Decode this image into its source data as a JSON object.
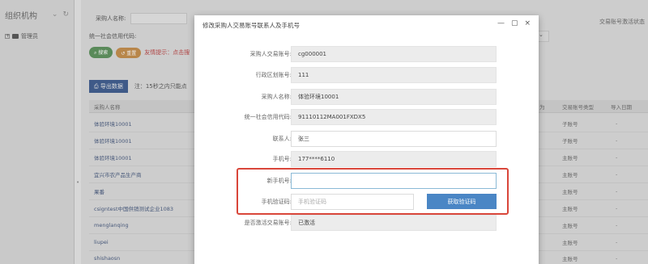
{
  "org_panel": {
    "title": "组织机构",
    "tree_root": "管理员"
  },
  "filters": {
    "purchaser_name_label": "采购人名称:",
    "credit_code_label": "统一社会信用代码:",
    "search_label": "搜索",
    "reset_label": "重置",
    "tip": "友情提示：点击搜",
    "right_text": "交易账号激活状态"
  },
  "toolbar": {
    "export_label": "导出数据",
    "note": "注：15秒之内只能点"
  },
  "table": {
    "head": {
      "name": "采购人名称",
      "col_a": "为",
      "col_type": "交易账号类型",
      "col_date": "导入日期"
    },
    "rows": [
      {
        "name": "体验环境10001",
        "type": "子账号",
        "dash": "-"
      },
      {
        "name": "体验环境10001",
        "type": "子账号",
        "dash": "-"
      },
      {
        "name": "体验环境10001",
        "type": "主账号",
        "dash": "-"
      },
      {
        "name": "宜兴市农产品生产商",
        "type": "主账号",
        "dash": "-"
      },
      {
        "name": "果番",
        "type": "主账号",
        "dash": "-"
      },
      {
        "name": "csigntest中国供销测试企业1083",
        "type": "主账号",
        "dash": "-"
      },
      {
        "name": "menglanqing",
        "type": "主账号",
        "dash": "-"
      },
      {
        "name": "liupei",
        "type": "主账号",
        "dash": "-"
      },
      {
        "name": "shishaosn",
        "type": "主账号",
        "dash": "-"
      }
    ]
  },
  "modal": {
    "title": "修改采购人交易账号联系人及手机号",
    "minimize": "—",
    "maximize": "▢",
    "close": "×",
    "fields": {
      "account_label": "采购人交易账号:",
      "account_value": "cg000001",
      "region_label": "行政区划账号:",
      "region_value": "111",
      "name_label": "采购人名称:",
      "name_value": "体验环境10001",
      "credit_label": "统一社会信用代码:",
      "credit_value": "91110112MA001FXDX5",
      "contact_label": "联系人:",
      "contact_value": "张三",
      "phone_label": "手机号:",
      "phone_value": "177****6110",
      "new_phone_label": "新手机号:",
      "new_phone_value": "",
      "code_label": "手机验证码:",
      "code_placeholder": "手机验证码",
      "get_code_label": "获取验证码",
      "active_label": "是否激活交易账号:",
      "active_value": "已激活"
    }
  }
}
